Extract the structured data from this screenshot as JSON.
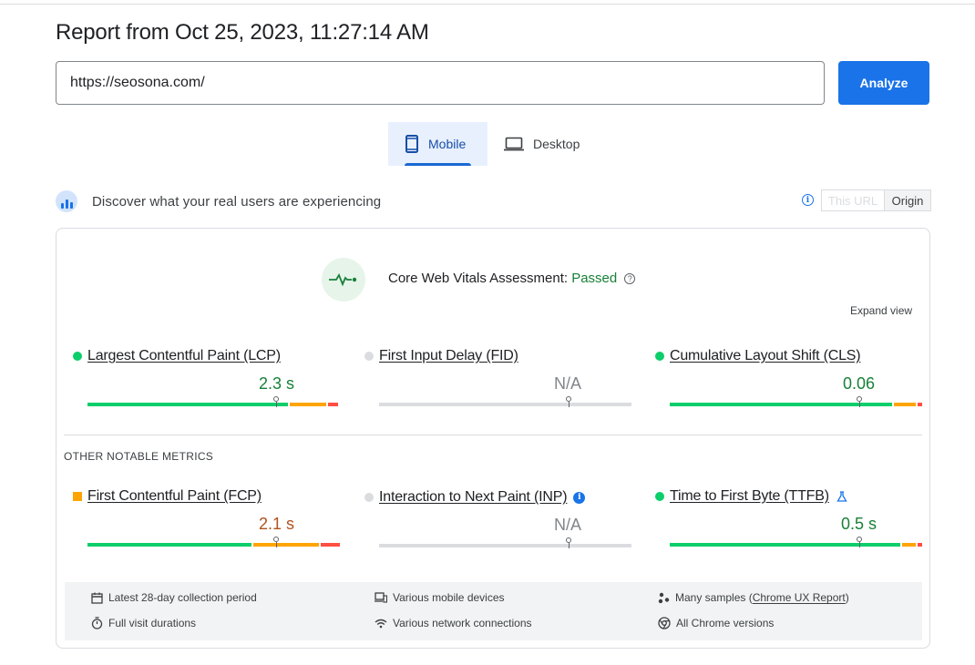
{
  "header": {
    "title": "Report from Oct 25, 2023, 11:27:14 AM"
  },
  "url_input": {
    "value": "https://seosona.com/"
  },
  "analyze_button": {
    "label": "Analyze"
  },
  "device_tabs": [
    {
      "label": "Mobile",
      "active": true,
      "icon": "smartphone-icon"
    },
    {
      "label": "Desktop",
      "active": false,
      "icon": "laptop-icon"
    }
  ],
  "field_data": {
    "heading": "Discover what your real users are experiencing",
    "toggle": {
      "this_url": "This URL",
      "origin": "Origin",
      "selected": "Origin"
    }
  },
  "assessment": {
    "label": "Core Web Vitals Assessment: ",
    "status": "Passed",
    "help": "?",
    "expand_label": "Expand view"
  },
  "core_metrics": [
    {
      "name": "Largest Contentful Paint (LCP)",
      "value": "2.3 s",
      "status": "good",
      "marker_fraction": 0.75,
      "distribution": [
        0.79,
        0.15,
        0.06
      ]
    },
    {
      "name": "First Input Delay (FID)",
      "value": "N/A",
      "status": "none",
      "marker_fraction": 0.75,
      "distribution": [
        1.0
      ]
    },
    {
      "name": "Cumulative Layout Shift (CLS)",
      "value": "0.06",
      "status": "good",
      "marker_fraction": 0.75,
      "distribution": [
        0.88,
        0.09,
        0.03
      ]
    }
  ],
  "other_metrics_label": "OTHER NOTABLE METRICS",
  "other_metrics": [
    {
      "name": "First Contentful Paint (FCP)",
      "value": "2.1 s",
      "status": "average",
      "marker_fraction": 0.75,
      "distribution": [
        0.66,
        0.26,
        0.08
      ],
      "suffix_icon": ""
    },
    {
      "name": "Interaction to Next Paint (INP)",
      "value": "N/A",
      "status": "none",
      "marker_fraction": 0.75,
      "distribution": [
        1.0
      ],
      "suffix_icon": "info-icon"
    },
    {
      "name": "Time to First Byte (TTFB)",
      "value": "0.5 s",
      "status": "good",
      "marker_fraction": 0.75,
      "distribution": [
        0.92,
        0.06,
        0.02
      ],
      "suffix_icon": "flask-icon"
    }
  ],
  "footer": {
    "collection_period": "Latest 28-day collection period",
    "visit_durations": "Full visit durations",
    "devices": "Various mobile devices",
    "network": "Various network connections",
    "samples_prefix": "Many samples (",
    "samples_link": "Chrome UX Report",
    "samples_suffix": ")",
    "chrome_versions": "All Chrome versions"
  },
  "colors": {
    "good": "#0cce6b",
    "average": "#ffa400",
    "poor": "#ff4e42",
    "na": "#dadce0",
    "good_text": "#188038",
    "average_text": "#b0521e",
    "na_text": "#80868b",
    "accent": "#1a73e8"
  }
}
